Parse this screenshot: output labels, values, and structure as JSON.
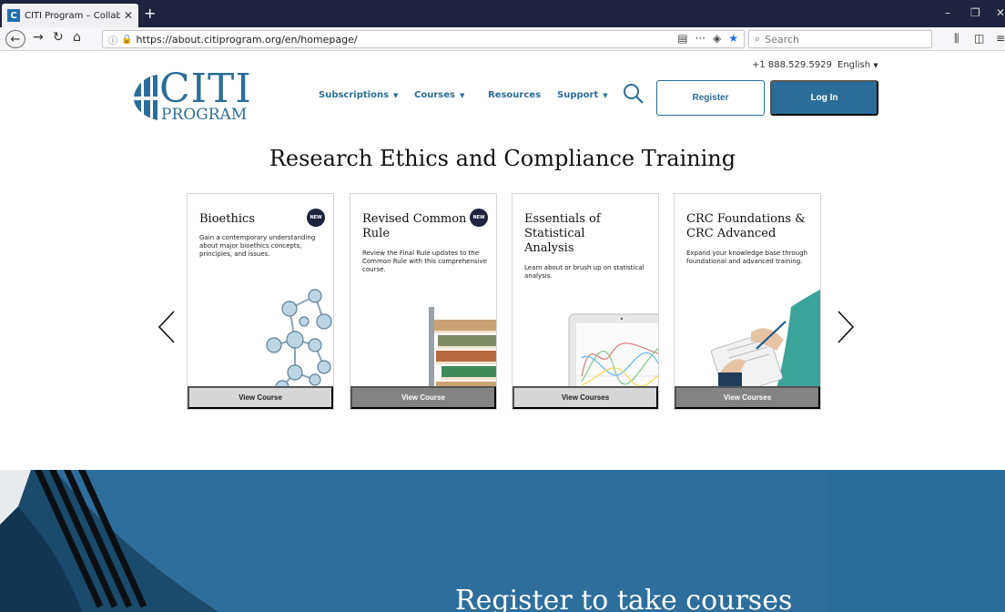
{
  "browser": {
    "tab_title": "CITI Program – Collaborative In",
    "tab_favicon": "C",
    "url": "https://about.citiprogram.org/en/homepage/",
    "search_placeholder": "Search"
  },
  "header": {
    "phone": "+1 888.529.5929",
    "language": "English",
    "logo_top": "CITI",
    "logo_bottom": "PROGRAM",
    "nav": [
      {
        "label": "Subscriptions",
        "dropdown": true
      },
      {
        "label": "Courses",
        "dropdown": true
      },
      {
        "label": "Resources",
        "dropdown": false
      },
      {
        "label": "Support",
        "dropdown": true
      }
    ],
    "register_label": "Register",
    "login_label": "Log In"
  },
  "hero": {
    "headline": "Research Ethics and Compliance Training"
  },
  "cards": [
    {
      "title": "Bioethics",
      "badge": "NEW",
      "description": "Gain a contemporary understanding about major bioethics concepts, principles, and issues.",
      "button": "View Course"
    },
    {
      "title": "Revised Common Rule",
      "badge": "NEW",
      "description": "Review the Final Rule updates to the Common Rule with this comprehensive course.",
      "button": "View Course"
    },
    {
      "title": "Essentials of Statistical Analysis",
      "badge": "",
      "description": "Learn about or brush up on statistical analysis.",
      "button": "View Courses"
    },
    {
      "title": "CRC Foundations & CRC Advanced",
      "badge": "",
      "description": "Expand your knowledge base through foundational and advanced training.",
      "button": "View Courses"
    }
  ],
  "band": {
    "cta": "Register to take courses"
  },
  "colors": {
    "brand": "#2b6d99",
    "navy": "#1f2340"
  }
}
